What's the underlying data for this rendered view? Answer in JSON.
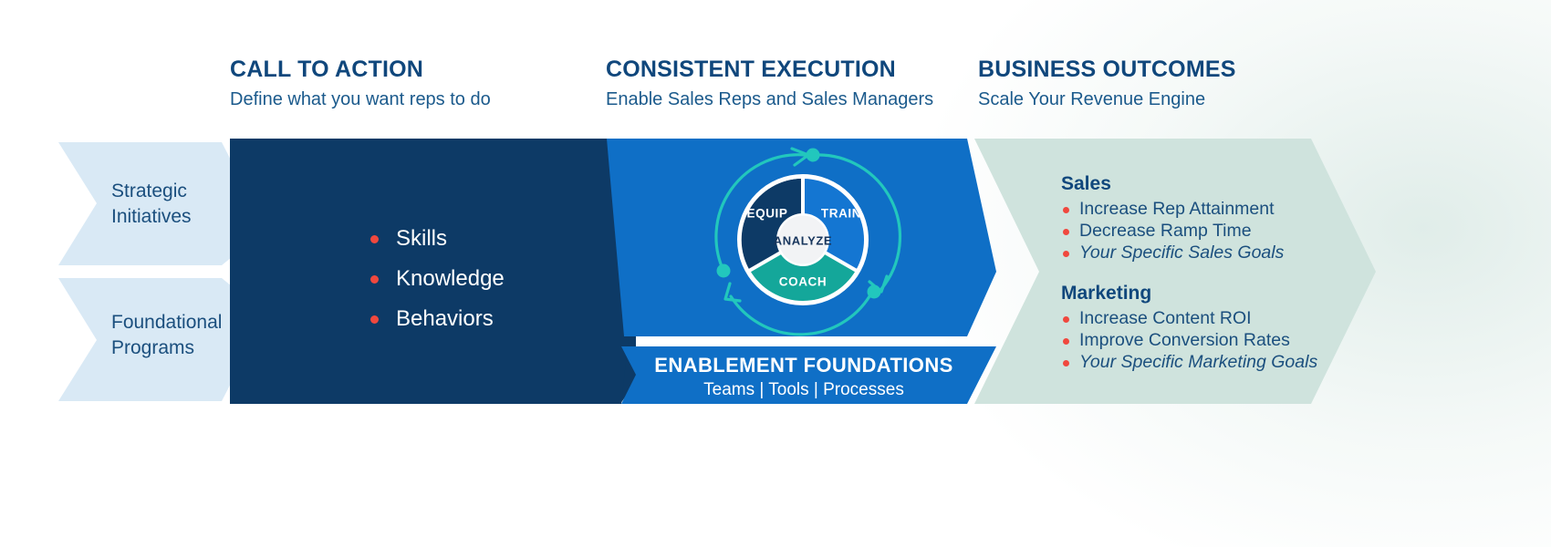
{
  "columns": [
    {
      "title": "CALL TO ACTION",
      "subtitle": "Define what you want reps to do"
    },
    {
      "title": "CONSISTENT EXECUTION",
      "subtitle": "Enable Sales Reps and Sales Managers"
    },
    {
      "title": "BUSINESS OUTCOMES",
      "subtitle": "Scale Your Revenue Engine"
    }
  ],
  "inputs": [
    {
      "line1": "Strategic",
      "line2": "Initiatives"
    },
    {
      "line1": "Foundational",
      "line2": "Programs"
    }
  ],
  "call_to_action": {
    "items": [
      "Skills",
      "Knowledge",
      "Behaviors"
    ]
  },
  "wheel": {
    "segments": [
      {
        "label": "EQUIP",
        "color": "#0d3a66"
      },
      {
        "label": "TRAIN",
        "color": "#1476d2"
      },
      {
        "label": "COACH",
        "color": "#14a79a"
      }
    ],
    "center": {
      "label": "ANALYZE",
      "color": "#f2f3f5"
    },
    "arrow_color": "#22c7bd"
  },
  "foundations": {
    "title": "ENABLEMENT FOUNDATIONS",
    "subtitle": "Teams | Tools | Processes"
  },
  "outcomes": [
    {
      "heading": "Sales",
      "items": [
        {
          "text": "Increase Rep Attainment",
          "italic": false
        },
        {
          "text": "Decrease Ramp Time",
          "italic": false
        },
        {
          "text": "Your Specific Sales Goals",
          "italic": true
        }
      ]
    },
    {
      "heading": "Marketing",
      "items": [
        {
          "text": "Increase Content ROI",
          "italic": false
        },
        {
          "text": "Improve Conversion Rates",
          "italic": false
        },
        {
          "text": "Your Specific Marketing Goals",
          "italic": true
        }
      ]
    }
  ],
  "colors": {
    "navy": "#0d3a66",
    "blue": "#0f6fc6",
    "light_blue_chevron": "#d9e9f5",
    "green_chevron": "#cfe3dd",
    "bullet_red": "#f0483e",
    "heading_navy": "#10477c",
    "teal": "#22c7bd"
  }
}
